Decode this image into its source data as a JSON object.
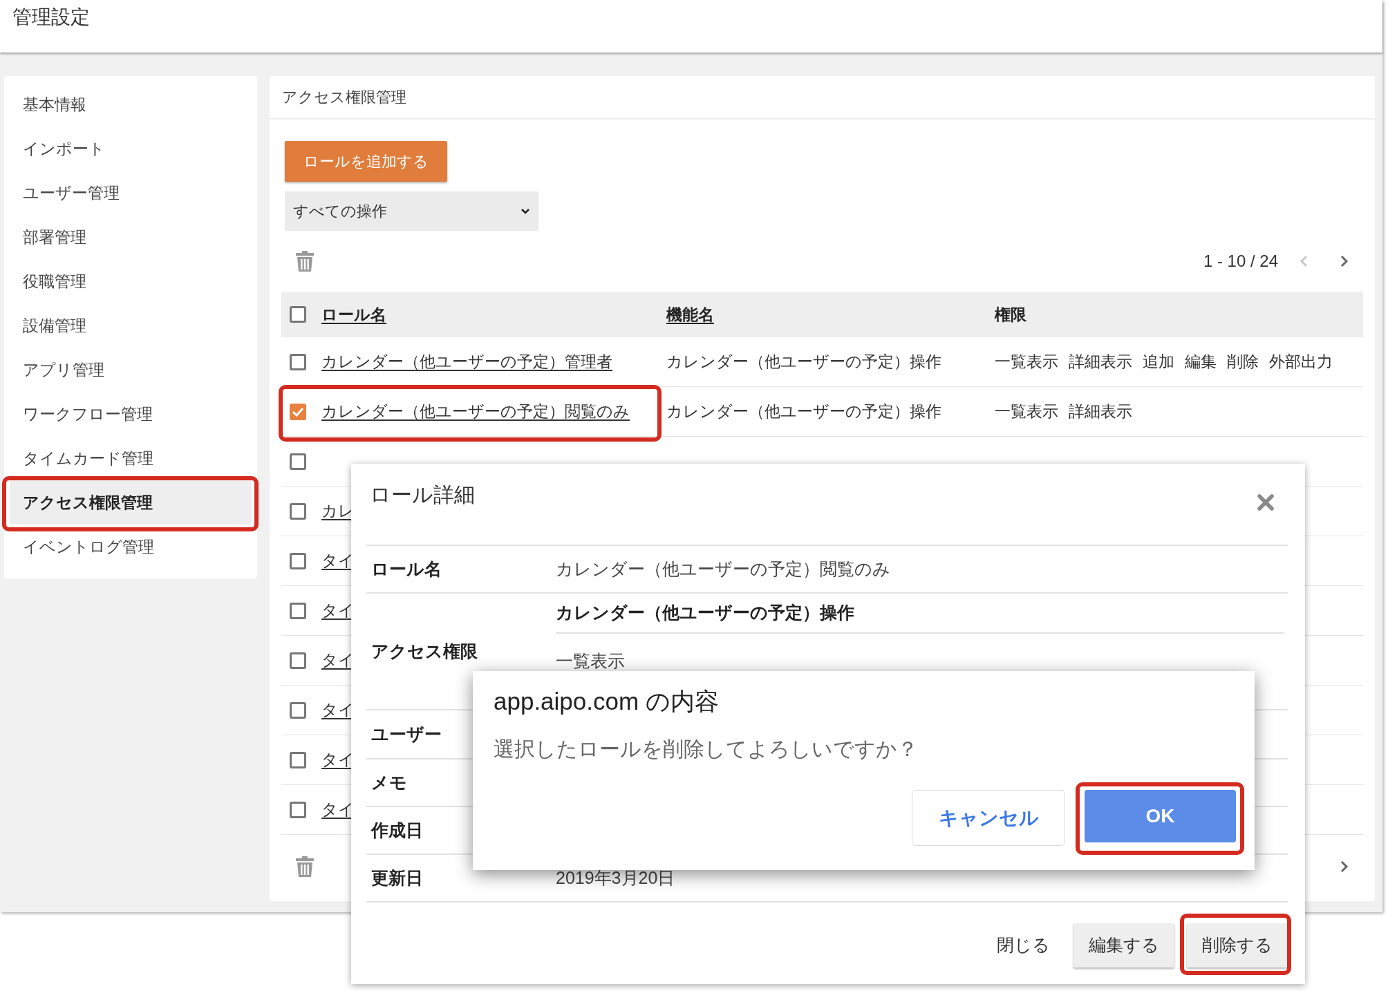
{
  "header": {
    "title": "管理設定"
  },
  "sidebar": {
    "items": [
      {
        "label": "基本情報",
        "selected": false,
        "highlighted": false
      },
      {
        "label": "インポート",
        "selected": false,
        "highlighted": false
      },
      {
        "label": "ユーザー管理",
        "selected": false,
        "highlighted": false
      },
      {
        "label": "部署管理",
        "selected": false,
        "highlighted": false
      },
      {
        "label": "役職管理",
        "selected": false,
        "highlighted": false
      },
      {
        "label": "設備管理",
        "selected": false,
        "highlighted": false
      },
      {
        "label": "アプリ管理",
        "selected": false,
        "highlighted": false
      },
      {
        "label": "ワークフロー管理",
        "selected": false,
        "highlighted": false
      },
      {
        "label": "タイムカード管理",
        "selected": false,
        "highlighted": false
      },
      {
        "label": "アクセス権限管理",
        "selected": true,
        "highlighted": true
      },
      {
        "label": "イベントログ管理",
        "selected": false,
        "highlighted": false
      }
    ]
  },
  "main": {
    "title": "アクセス権限管理",
    "add_button": "ロールを追加する",
    "filter": {
      "value": "すべての操作"
    },
    "pager": {
      "text": "1 - 10 / 24",
      "prev_disabled": true
    },
    "table": {
      "header_checked": false,
      "columns": [
        {
          "label": "ロール名",
          "sortable": true
        },
        {
          "label": "機能名",
          "sortable": true
        },
        {
          "label": "権限",
          "sortable": false
        }
      ],
      "rows": [
        {
          "checked": false,
          "highlighted": false,
          "role": "カレンダー（他ユーザーの予定）管理者",
          "feature": "カレンダー（他ユーザーの予定）操作",
          "permissions": [
            "一覧表示",
            "詳細表示",
            "追加",
            "編集",
            "削除",
            "外部出力"
          ]
        },
        {
          "checked": true,
          "highlighted": true,
          "role": "カレンダー（他ユーザーの予定）閲覧のみ",
          "feature": "カレンダー（他ユーザーの予定）操作",
          "permissions": [
            "一覧表示",
            "詳細表示"
          ]
        },
        {
          "checked": false,
          "highlighted": false
        },
        {
          "checked": false,
          "highlighted": false,
          "role": "カレ"
        },
        {
          "checked": false,
          "highlighted": false,
          "role": "タイ"
        },
        {
          "checked": false,
          "highlighted": false,
          "role": "タイ"
        },
        {
          "checked": false,
          "highlighted": false,
          "role": "タイ"
        },
        {
          "checked": false,
          "highlighted": false,
          "role": "タイ"
        },
        {
          "checked": false,
          "highlighted": false,
          "role": "タイ"
        },
        {
          "checked": false,
          "highlighted": false,
          "role": "タイ"
        }
      ]
    }
  },
  "role_dialog": {
    "title": "ロール詳細",
    "fields": [
      {
        "label": "ロール名",
        "value": "カレンダー（他ユーザーの予定）閲覧のみ"
      },
      {
        "label": "アクセス権限",
        "group": "カレンダー（他ユーザーの予定）操作",
        "value": "一覧表示"
      },
      {
        "label": "ユーザー"
      },
      {
        "label": "メモ"
      },
      {
        "label": "作成日"
      },
      {
        "label": "更新日",
        "value": "2019年3月20日"
      }
    ],
    "buttons": [
      {
        "label": "閉じる",
        "kind": "flat",
        "highlighted": false
      },
      {
        "label": "編集する",
        "kind": "raised",
        "highlighted": false
      },
      {
        "label": "削除する",
        "kind": "raised",
        "highlighted": true
      }
    ]
  },
  "confirm": {
    "title": "app.aipo.com の内容",
    "message": "選択したロールを削除してよろしいですか？",
    "buttons": [
      {
        "label": "キャンセル",
        "kind": "secondary",
        "highlighted": false
      },
      {
        "label": "OK",
        "kind": "primary",
        "highlighted": true
      }
    ]
  }
}
